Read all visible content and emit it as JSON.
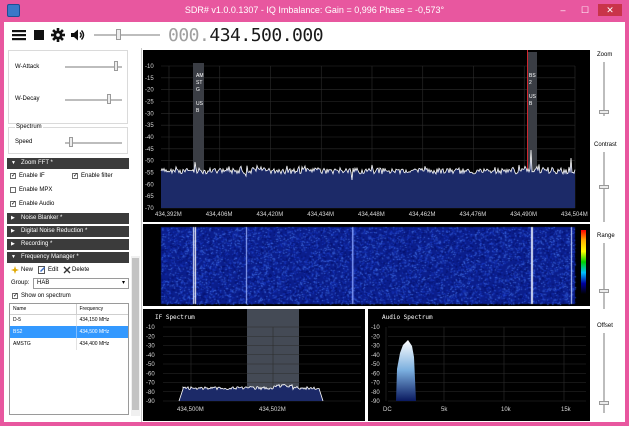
{
  "window": {
    "title": "SDR# v1.0.0.1307 - IQ Imbalance: Gain = 0,996 Phase = -0,573°",
    "minimize": "–",
    "maximize": "☐",
    "close": "✕"
  },
  "toolbar": {
    "freq_prefix": "000.",
    "freq_main": "434.500.000",
    "icons": [
      "menu-icon",
      "stop-icon",
      "gear-icon",
      "speaker-icon"
    ]
  },
  "left_panel": {
    "agc": {
      "attack_label": "W-Attack",
      "decay_label": "W-Decay"
    },
    "spectrum_group": {
      "title": "Spectrum",
      "speed_label": "Speed"
    },
    "zoom_fft": {
      "header": "Zoom FFT *",
      "enable_if": "Enable IF",
      "enable_filter": "Enable filter",
      "enable_mpx": "Enable MPX",
      "enable_audio": "Enable Audio"
    },
    "headers": [
      "Noise Blanker *",
      "Digital Noise Reduction *",
      "Recording *",
      "Frequency Manager *"
    ],
    "freq_manager": {
      "new": "New",
      "edit": "Edit",
      "delete": "Delete",
      "group_label": "Group:",
      "group_value": "HAB",
      "show_on_spectrum": "Show on spectrum",
      "columns": [
        "Name",
        "Frequency"
      ],
      "rows": [
        {
          "name": "D-5",
          "freq": "434,150 MHz"
        },
        {
          "name": "BS2",
          "freq": "434,500 MHz"
        },
        {
          "name": "AMSTG",
          "freq": "434,400 MHz"
        }
      ],
      "selected_row": 1
    }
  },
  "main_spectrum": {
    "y_labels": [
      "-10",
      "-15",
      "-20",
      "-25",
      "-30",
      "-35",
      "-40",
      "-45",
      "-50",
      "-55",
      "-60",
      "-65",
      "-70"
    ],
    "x_labels": [
      "434,392M",
      "434,406M",
      "434,420M",
      "434,434M",
      "434,448M",
      "434,462M",
      "434,476M",
      "434,490M",
      "434,504M"
    ],
    "marker_amstg": [
      "AM",
      "ST",
      "G",
      "",
      "US",
      "B"
    ],
    "marker_bs2": [
      "BS",
      "2",
      "",
      "US",
      "B"
    ]
  },
  "if_spectrum": {
    "title": "IF Spectrum",
    "y_labels": [
      "-10",
      "-20",
      "-30",
      "-40",
      "-50",
      "-60",
      "-70",
      "-80",
      "-90"
    ],
    "x_labels": [
      "434,500M",
      "434,502M"
    ]
  },
  "audio_spectrum": {
    "title": "Audio Spectrum",
    "y_labels": [
      "-10",
      "-20",
      "-30",
      "-40",
      "-50",
      "-60",
      "-70",
      "-80",
      "-90"
    ],
    "x_labels": [
      "DC",
      "5k",
      "10k",
      "15k"
    ]
  },
  "right_panel": {
    "zoom": "Zoom",
    "contrast": "Contrast",
    "range": "Range",
    "offset": "Offset"
  },
  "colors": {
    "title_bar": "#e8579f",
    "spectrum_bg": "#000000",
    "trace_fill": "#1c2a68",
    "header_bg": "#3b3b3b",
    "selected_row": "#3399ff"
  }
}
